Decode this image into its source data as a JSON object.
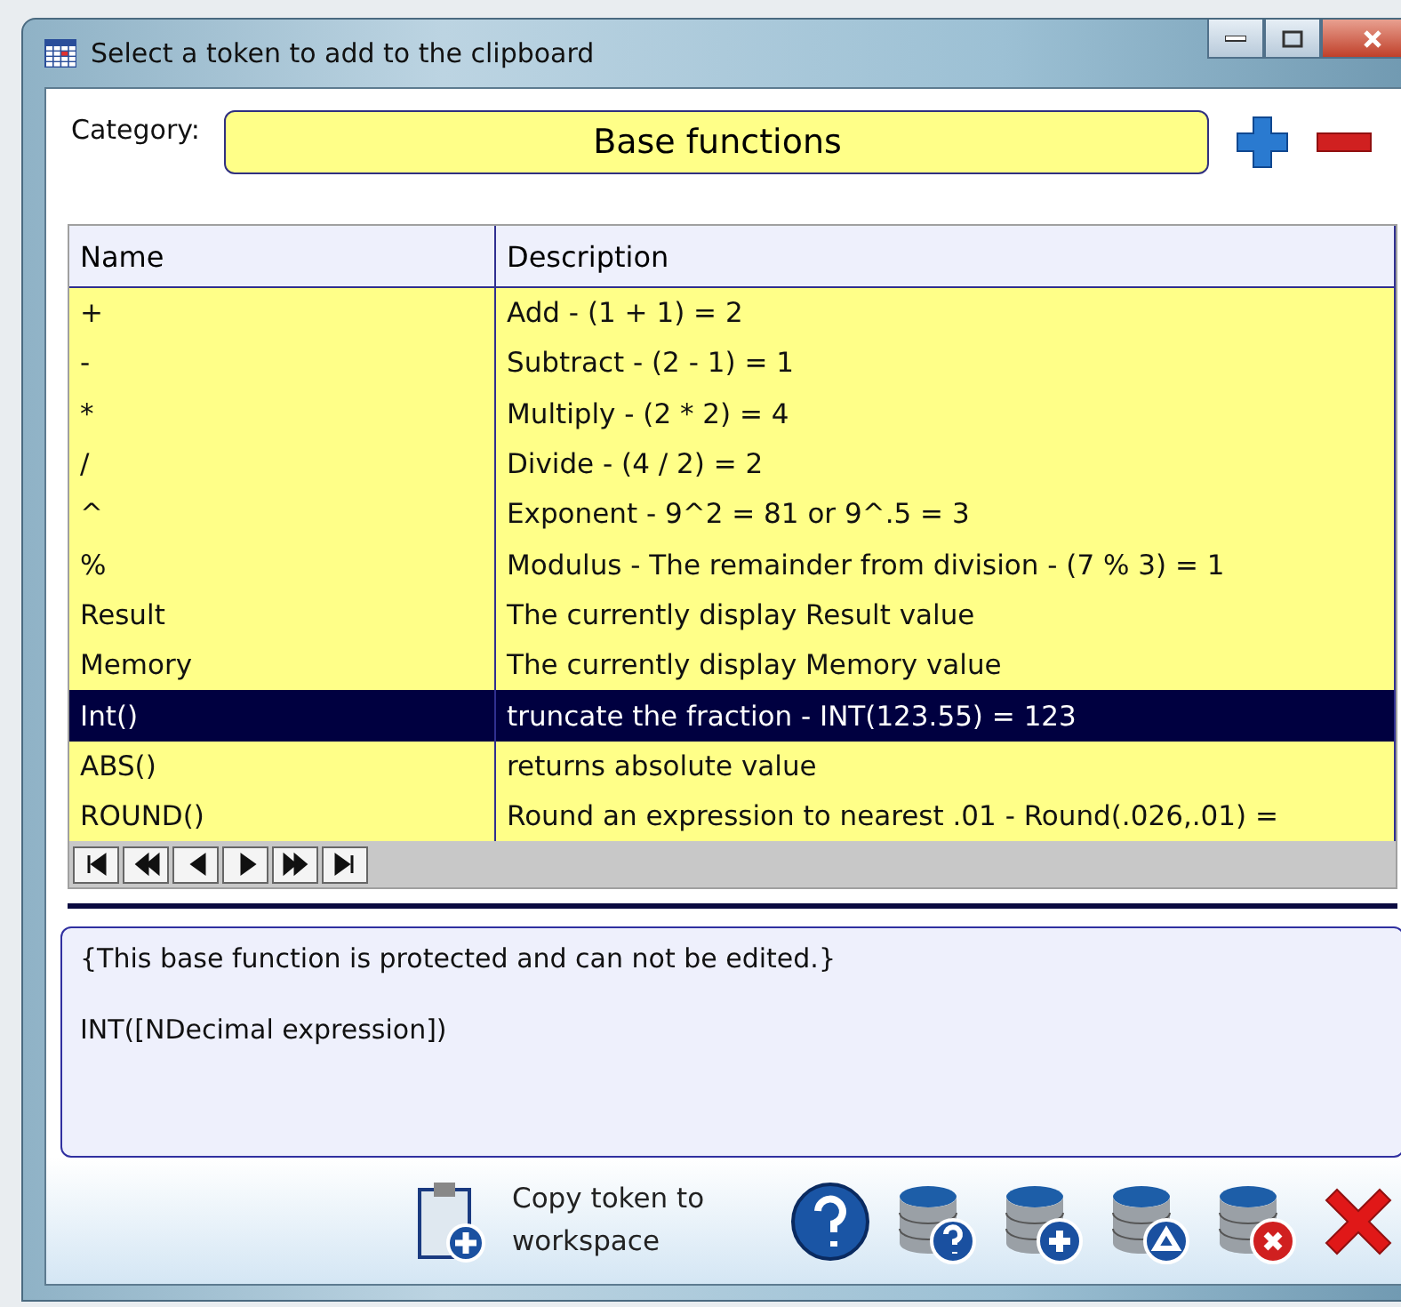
{
  "window": {
    "title": "Select a token to add to the clipboard"
  },
  "category": {
    "label": "Category:",
    "value": "Base functions"
  },
  "table": {
    "columns": [
      "Name",
      "Description"
    ],
    "rows": [
      {
        "name": "+",
        "description": "Add - (1 + 1) = 2",
        "selected": false
      },
      {
        "name": "-",
        "description": "Subtract - (2 - 1) = 1",
        "selected": false
      },
      {
        "name": "*",
        "description": "Multiply - (2 * 2) = 4",
        "selected": false
      },
      {
        "name": "/",
        "description": "Divide - (4 / 2) = 2",
        "selected": false
      },
      {
        "name": "^",
        "description": "Exponent - 9^2 = 81 or 9^.5 = 3",
        "selected": false
      },
      {
        "name": "%",
        "description": "Modulus - The remainder from division - (7 % 3) = 1",
        "selected": false
      },
      {
        "name": "Result",
        "description": "The currently display Result value",
        "selected": false
      },
      {
        "name": "Memory",
        "description": "The currently display Memory value",
        "selected": false
      },
      {
        "name": "Int()",
        "description": "truncate the fraction - INT(123.55) = 123",
        "selected": true
      },
      {
        "name": "ABS()",
        "description": "returns absolute value",
        "selected": false
      },
      {
        "name": "ROUND()",
        "description": "Round an expression to nearest .01 - Round(.026,.01) =",
        "selected": false
      }
    ]
  },
  "details": {
    "lines": [
      "{This base function is protected and can not be edited.}",
      "INT([NDecimal expression])"
    ]
  },
  "copy_button": {
    "label": "Copy token to workspace"
  }
}
